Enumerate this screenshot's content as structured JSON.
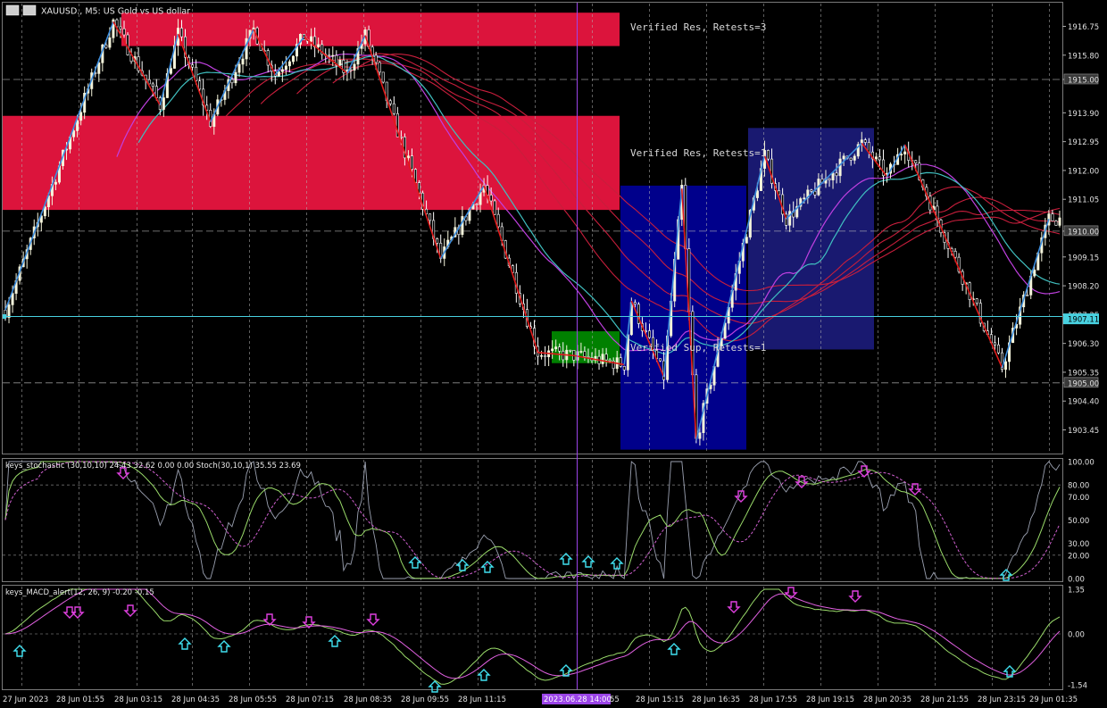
{
  "header": {
    "symbol_title": "XAUUSD., M5: US Gold vs US dollar",
    "icons": [
      "chart-menu-icon",
      "one-click-trading-icon"
    ]
  },
  "zone_labels": [
    {
      "text": "Verified Res, Retests=3",
      "price": 1916.6
    },
    {
      "text": "Verified Res, Retests=1",
      "price": 1912.45
    },
    {
      "text": "Verified Sup, Retests=1",
      "price": 1906.05
    }
  ],
  "price_axis": {
    "ticks": [
      "1916.75",
      "1915.80",
      "1915.00",
      "1913.90",
      "1912.95",
      "1912.00",
      "1911.05",
      "1910.00",
      "1909.15",
      "1908.20",
      "1907.25",
      "1906.30",
      "1905.35",
      "1905.00",
      "1904.40",
      "1903.45"
    ],
    "tick_values": [
      1916.75,
      1915.8,
      1915.0,
      1913.9,
      1912.95,
      1912.0,
      1911.05,
      1910.0,
      1909.15,
      1908.2,
      1907.25,
      1906.3,
      1905.35,
      1905.0,
      1904.4,
      1903.45
    ],
    "boxed_levels": [
      "1915.00",
      "1910.00",
      "1905.00"
    ],
    "current_price_label": "1907.11",
    "current_price": 1907.11,
    "range": [
      1902.7,
      1917.5
    ]
  },
  "time_axis": {
    "labels": [
      "27 Jun 2023",
      "28 Jun 01:55",
      "28 Jun 03:15",
      "28 Jun 04:35",
      "28 Jun 05:55",
      "28 Jun 07:15",
      "28 Jun 08:35",
      "28 Jun 09:55",
      "28 Jun 11:15",
      "",
      "28 Jun 15:15",
      "28 Jun 16:35",
      "28 Jun 17:55",
      "28 Jun 19:15",
      "28 Jun 20:35",
      "28 Jun 21:55",
      "28 Jun 23:15",
      "29 Jun 01:35"
    ],
    "crosshair_label": "2023.06.28 14:00",
    "partial_label": "55"
  },
  "stoch_panel": {
    "title": "keys_stochastic (30,10,10) 24.43 32.62 0.00 0.00 Stoch(30,10,1) 35.55 23.69",
    "ticks": [
      "100.00",
      "80.00",
      "70.00",
      "50.00",
      "30.00",
      "20.00",
      "0.00"
    ],
    "tick_values": [
      100,
      80,
      70,
      50,
      30,
      20,
      0
    ]
  },
  "macd_panel": {
    "title": "keys_MACD_alert(12, 26, 9) -0.20 -0.15",
    "ticks": [
      "1.35",
      "0.00",
      "-1.54"
    ],
    "tick_values": [
      1.35,
      0,
      -1.54
    ]
  },
  "colors": {
    "background": "#000000",
    "resistance_zone": "#DC143C",
    "support_zone": "#008000",
    "blue_box": "#00008B",
    "navy_box": "#191970",
    "bull_candle": "#F5F5DC",
    "bear_candle": "#FFFFFF",
    "zigzag_up": "#3C8CDC",
    "zigzag_down": "#E11A1A",
    "crosshair": "#9B44E8",
    "current_price_line": "#48D1E0",
    "buy_arrow": "#40E0F0",
    "sell_arrow": "#E040E0"
  },
  "chart_data": {
    "type": "candlestick",
    "title": "XAUUSD., M5: US Gold vs US dollar",
    "ylim": [
      1902.7,
      1917.5
    ],
    "zigzag": [
      {
        "t": 0,
        "p": 1907.4
      },
      {
        "t": 30,
        "p": 1916.9
      },
      {
        "t": 43,
        "p": 1914.15
      },
      {
        "t": 48,
        "p": 1916.5
      },
      {
        "t": 57,
        "p": 1913.6
      },
      {
        "t": 69,
        "p": 1916.65
      },
      {
        "t": 75,
        "p": 1915.15
      },
      {
        "t": 83,
        "p": 1916.4
      },
      {
        "t": 95,
        "p": 1915.2
      },
      {
        "t": 100,
        "p": 1916.45
      },
      {
        "t": 121,
        "p": 1909.1
      },
      {
        "t": 133,
        "p": 1911.5
      },
      {
        "t": 148,
        "p": 1906.0
      },
      {
        "t": 158,
        "p": 1905.9
      },
      {
        "t": 172,
        "p": 1905.6
      },
      {
        "t": 174,
        "p": 1907.7
      },
      {
        "t": 183,
        "p": 1905.2
      },
      {
        "t": 188,
        "p": 1911.4
      },
      {
        "t": 192,
        "p": 1903.1
      },
      {
        "t": 211,
        "p": 1912.5
      },
      {
        "t": 217,
        "p": 1910.4
      },
      {
        "t": 238,
        "p": 1912.9
      },
      {
        "t": 245,
        "p": 1911.8
      },
      {
        "t": 250,
        "p": 1912.85
      },
      {
        "t": 277,
        "p": 1905.5
      },
      {
        "t": 290,
        "p": 1910.4
      }
    ],
    "zones": [
      {
        "label": "Verified Res, Retests=3",
        "top": 1917.2,
        "bottom": 1916.1
      },
      {
        "label": "Verified Res, Retests=1",
        "top": 1913.8,
        "bottom": 1910.7
      },
      {
        "label": "Verified Sup, Retests=1",
        "top": 1906.7,
        "bottom": 1905.65
      }
    ]
  }
}
